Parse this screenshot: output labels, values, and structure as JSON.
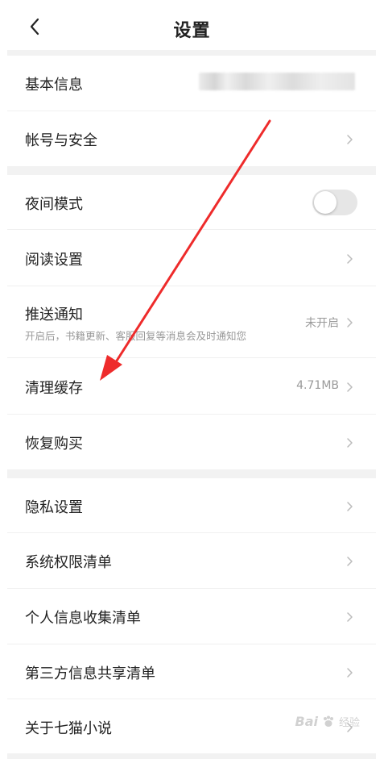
{
  "header": {
    "title": "设置",
    "back_icon": "chevron-left-icon"
  },
  "rows": {
    "basic_info": {
      "label": "基本信息"
    },
    "account_security": {
      "label": "帐号与安全"
    },
    "night_mode": {
      "label": "夜间模式",
      "toggle_on": false
    },
    "reading_settings": {
      "label": "阅读设置"
    },
    "push_notify": {
      "label": "推送通知",
      "subtitle": "开启后，书籍更新、客服回复等消息会及时通知您",
      "value": "未开启"
    },
    "clear_cache": {
      "label": "清理缓存",
      "value": "4.71MB"
    },
    "restore_purchase": {
      "label": "恢复购买"
    },
    "privacy": {
      "label": "隐私设置"
    },
    "system_permissions": {
      "label": "系统权限清单"
    },
    "personal_info": {
      "label": "个人信息收集清单"
    },
    "third_party": {
      "label": "第三方信息共享清单"
    },
    "about": {
      "label": "关于七猫小说"
    }
  },
  "watermark": {
    "text": "Bai",
    "sub": "经验"
  },
  "colors": {
    "background": "#ffffff",
    "divider": "#f2f2f2",
    "text": "#222222",
    "muted": "#999999",
    "annotation": "#ee2b2b",
    "toggle_off": "#e6e6e6"
  }
}
